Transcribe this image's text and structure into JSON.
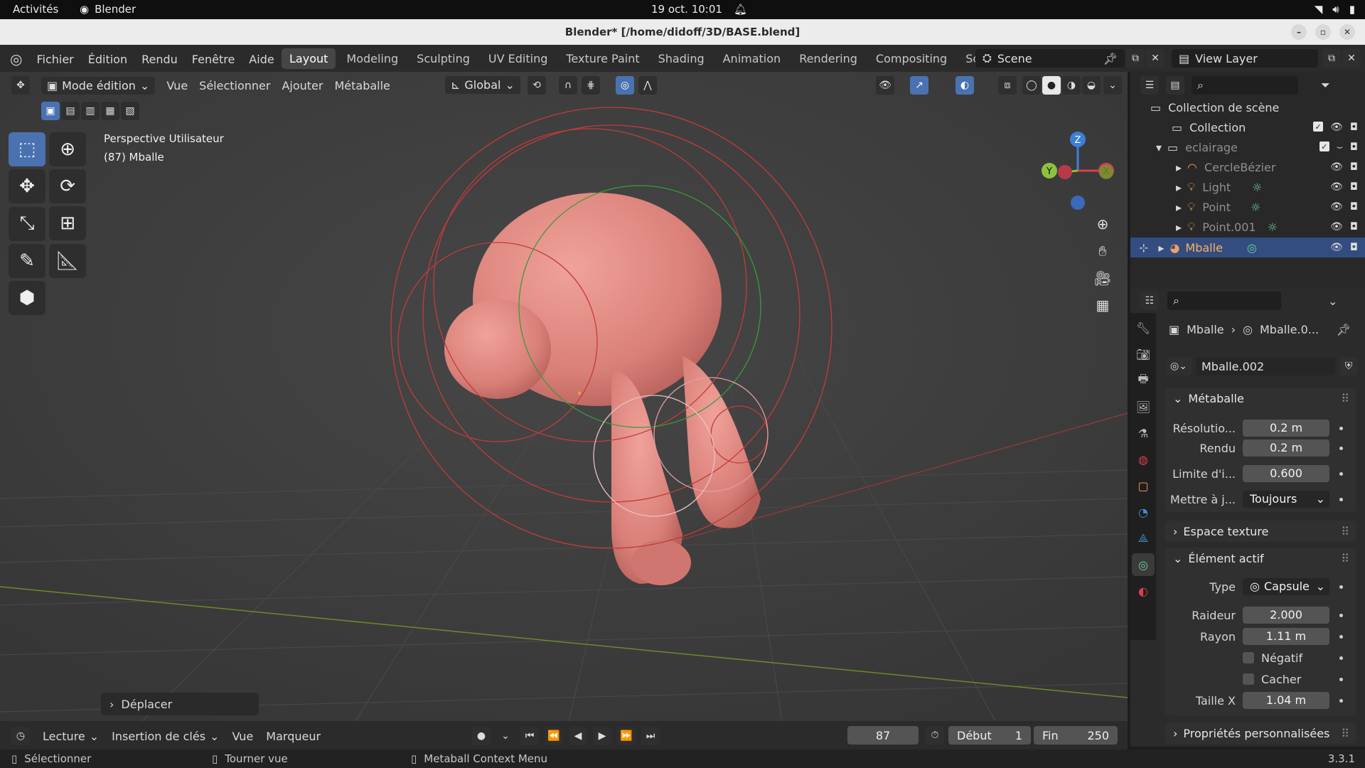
{
  "os_bar": {
    "activities": "Activités",
    "app_name": "Blender",
    "clock": "19 oct.  10:01"
  },
  "window": {
    "title": "Blender* [/home/didoff/3D/BASE.blend]"
  },
  "top_menu": {
    "items": [
      "Fichier",
      "Édition",
      "Rendu",
      "Fenêtre",
      "Aide"
    ],
    "workspace_tabs": [
      "Layout",
      "Modeling",
      "Sculpting",
      "UV Editing",
      "Texture Paint",
      "Shading",
      "Animation",
      "Rendering",
      "Compositing",
      "Scriptir"
    ],
    "active_tab": "Layout",
    "scene": "Scene",
    "view_layer": "View Layer"
  },
  "viewport_header": {
    "mode": "Mode édition",
    "menus": [
      "Vue",
      "Sélectionner",
      "Ajouter",
      "Métaballe"
    ],
    "orientation": "Global"
  },
  "viewport": {
    "view_name": "Perspective Utilisateur",
    "object_info": "(87) Mballe",
    "last_op": "Déplacer",
    "gizmo": {
      "z": "Z",
      "y": "Y",
      "x": "X"
    }
  },
  "outliner": {
    "root": "Collection de scène",
    "rows": [
      {
        "label": "Collection"
      },
      {
        "label": "eclairage"
      },
      {
        "label": "CercleBézier"
      },
      {
        "label": "Light"
      },
      {
        "label": "Point"
      },
      {
        "label": "Point.001"
      },
      {
        "label": "Mballe"
      }
    ]
  },
  "properties": {
    "breadcrumb_object": "Mballe",
    "breadcrumb_data": "Mballe.0...",
    "datablock": "Mballe.002",
    "metaball_panel": {
      "title": "Métaballe",
      "fields": [
        {
          "label": "Résolutio...",
          "value": "0.2 m"
        },
        {
          "label": "Rendu",
          "value": "0.2 m"
        },
        {
          "label": "Limite d'i...",
          "value": "0.600"
        },
        {
          "label": "Mettre à j...",
          "value": "Toujours"
        }
      ]
    },
    "texture_space_panel": {
      "title": "Espace texture"
    },
    "active_element_panel": {
      "title": "Élément actif",
      "type_label": "Type",
      "type_value": "Capsule",
      "stiffness_label": "Raideur",
      "stiffness_value": "2.000",
      "radius_label": "Rayon",
      "radius_value": "1.11 m",
      "negative_label": "Négatif",
      "hide_label": "Cacher",
      "size_x_label": "Taille X",
      "size_x_value": "1.04 m"
    },
    "custom_props_panel": {
      "title": "Propriétés personnalisées"
    }
  },
  "timeline": {
    "playback": "Lecture",
    "keying": "Insertion de clés",
    "view": "Vue",
    "marker": "Marqueur",
    "current_frame": "87",
    "start_label": "Début",
    "start_value": "1",
    "end_label": "Fin",
    "end_value": "250"
  },
  "status_bar": {
    "select": "Sélectionner",
    "rotate": "Tourner vue",
    "context": "Metaball Context Menu",
    "version": "3.3.1"
  },
  "colors": {
    "accent_blue": "#4a72b0",
    "selection_row": "#334d80",
    "metaball_pink": "#d98079",
    "axis_x": "#d84050",
    "axis_y": "#8dc33c",
    "axis_z": "#3c7fd8"
  }
}
